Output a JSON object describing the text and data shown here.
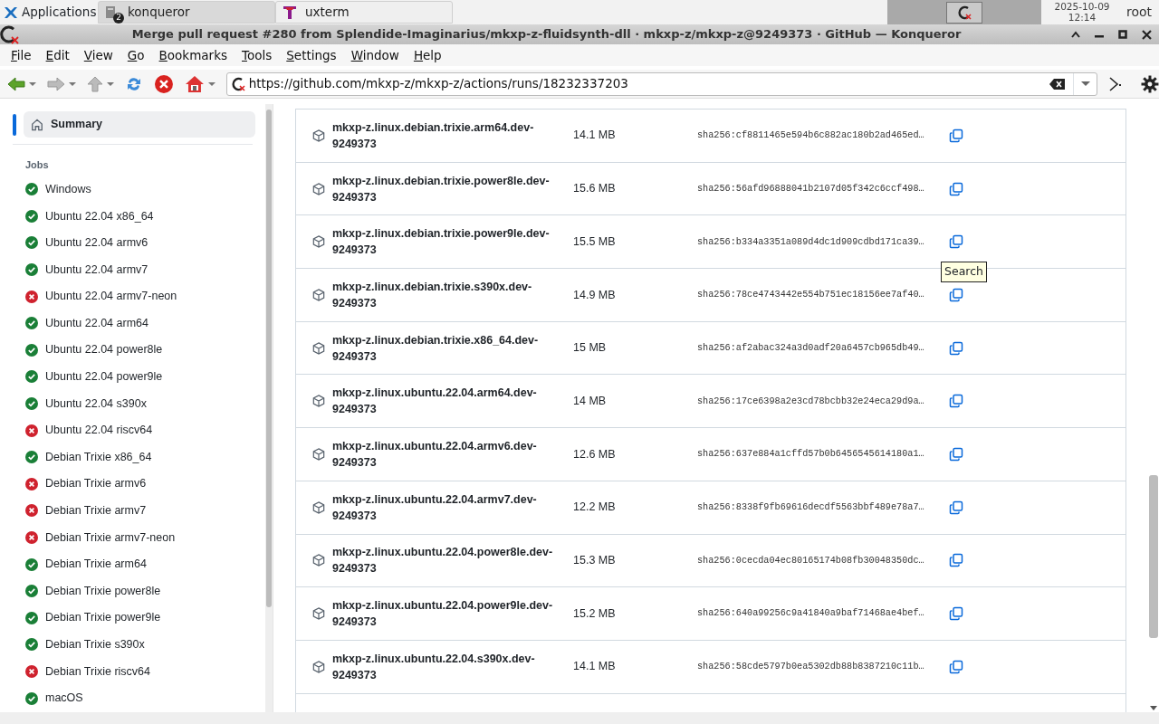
{
  "taskbar": {
    "launcher": "Applications",
    "tasks": [
      {
        "label": "konqueror",
        "badge": "2",
        "selected": true
      },
      {
        "label": "uxterm",
        "selected": false
      }
    ],
    "date": "2025-10-09",
    "time": "12:14",
    "user": "root"
  },
  "window": {
    "title": "Merge pull request #280 from Splendide-Imaginarius/mkxp-z-fluidsynth-dll · mkxp-z/mkxp-z@9249373 · GitHub — Konqueror"
  },
  "menu": [
    "File",
    "Edit",
    "View",
    "Go",
    "Bookmarks",
    "Tools",
    "Settings",
    "Window",
    "Help"
  ],
  "address": {
    "value": "https://github.com/mkxp-z/mkxp-z/actions/runs/18232337203"
  },
  "sidebar": {
    "summary": {
      "label": "Summary",
      "selected": true
    },
    "jobs_heading": "Jobs",
    "jobs": [
      {
        "label": "Windows",
        "failed": false
      },
      {
        "label": "Ubuntu 22.04 x86_64",
        "failed": false
      },
      {
        "label": "Ubuntu 22.04 armv6",
        "failed": false
      },
      {
        "label": "Ubuntu 22.04 armv7",
        "failed": false
      },
      {
        "label": "Ubuntu 22.04 armv7-neon",
        "failed": true
      },
      {
        "label": "Ubuntu 22.04 arm64",
        "failed": false
      },
      {
        "label": "Ubuntu 22.04 power8le",
        "failed": false
      },
      {
        "label": "Ubuntu 22.04 power9le",
        "failed": false
      },
      {
        "label": "Ubuntu 22.04 s390x",
        "failed": false
      },
      {
        "label": "Ubuntu 22.04 riscv64",
        "failed": true
      },
      {
        "label": "Debian Trixie x86_64",
        "failed": false
      },
      {
        "label": "Debian Trixie armv6",
        "failed": true
      },
      {
        "label": "Debian Trixie armv7",
        "failed": true
      },
      {
        "label": "Debian Trixie armv7-neon",
        "failed": true
      },
      {
        "label": "Debian Trixie arm64",
        "failed": false
      },
      {
        "label": "Debian Trixie power8le",
        "failed": false
      },
      {
        "label": "Debian Trixie power9le",
        "failed": false
      },
      {
        "label": "Debian Trixie s390x",
        "failed": false
      },
      {
        "label": "Debian Trixie riscv64",
        "failed": true
      },
      {
        "label": "macOS",
        "failed": false
      }
    ]
  },
  "artifacts": [
    {
      "name": "mkxp-z.linux.debian.trixie.arm64.dev-9249373",
      "size": "14.1 MB",
      "digest": "sha256:cf8811465e594b6c882ac180b2ad465ed…"
    },
    {
      "name": "mkxp-z.linux.debian.trixie.power8le.dev-9249373",
      "size": "15.6 MB",
      "digest": "sha256:56afd96888041b2107d05f342c6ccf498…"
    },
    {
      "name": "mkxp-z.linux.debian.trixie.power9le.dev-9249373",
      "size": "15.5 MB",
      "digest": "sha256:b334a3351a089d4dc1d909cdbd171ca39…"
    },
    {
      "name": "mkxp-z.linux.debian.trixie.s390x.dev-9249373",
      "size": "14.9 MB",
      "digest": "sha256:78ce4743442e554b751ec18156ee7af40…"
    },
    {
      "name": "mkxp-z.linux.debian.trixie.x86_64.dev-9249373",
      "size": "15 MB",
      "digest": "sha256:af2abac324a3d0adf20a6457cb965db49…"
    },
    {
      "name": "mkxp-z.linux.ubuntu.22.04.arm64.dev-9249373",
      "size": "14 MB",
      "digest": "sha256:17ce6398a2e3cd78bcbb32e24eca29d9a…"
    },
    {
      "name": "mkxp-z.linux.ubuntu.22.04.armv6.dev-9249373",
      "size": "12.6 MB",
      "digest": "sha256:637e884a1cffd57b0b6456545614180a1…"
    },
    {
      "name": "mkxp-z.linux.ubuntu.22.04.armv7.dev-9249373",
      "size": "12.2 MB",
      "digest": "sha256:8338f9fb69616decdf5563bbf489e78a7…"
    },
    {
      "name": "mkxp-z.linux.ubuntu.22.04.power8le.dev-9249373",
      "size": "15.3 MB",
      "digest": "sha256:0cecda04ec80165174b08fb30048350dc…"
    },
    {
      "name": "mkxp-z.linux.ubuntu.22.04.power9le.dev-9249373",
      "size": "15.2 MB",
      "digest": "sha256:640a99256c9a41840a9baf71468ae4bef…"
    },
    {
      "name": "mkxp-z.linux.ubuntu.22.04.s390x.dev-9249373",
      "size": "14.1 MB",
      "digest": "sha256:58cde5797b0ea5302db88b8387210c11b…"
    }
  ],
  "tooltip": "Search"
}
